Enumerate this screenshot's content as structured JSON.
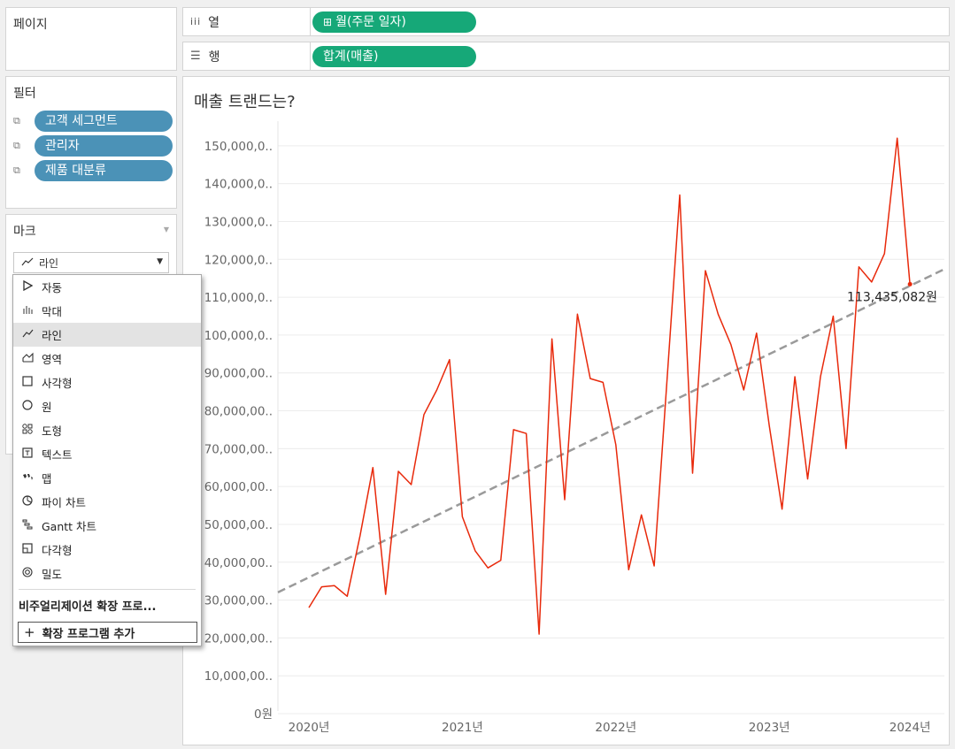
{
  "pages_panel": {
    "title": "페이지"
  },
  "columns_shelf": {
    "label": "열",
    "icon": "columns-icon",
    "pill": "월(주문 일자)"
  },
  "rows_shelf": {
    "label": "행",
    "icon": "rows-icon",
    "pill": "합계(매출)"
  },
  "filters_panel": {
    "title": "필터",
    "items": [
      "고객 세그먼트",
      "관리자",
      "제품 대분류"
    ]
  },
  "marks_panel": {
    "title": "마크",
    "selected": "라인"
  },
  "mark_type_menu": {
    "items": [
      {
        "label": "자동",
        "icon": "automatic-icon"
      },
      {
        "label": "막대",
        "icon": "bar-icon"
      },
      {
        "label": "라인",
        "icon": "line-icon"
      },
      {
        "label": "영역",
        "icon": "area-icon"
      },
      {
        "label": "사각형",
        "icon": "square-icon"
      },
      {
        "label": "원",
        "icon": "circle-icon"
      },
      {
        "label": "도형",
        "icon": "shape-icon"
      },
      {
        "label": "텍스트",
        "icon": "text-icon"
      },
      {
        "label": "맵",
        "icon": "map-icon"
      },
      {
        "label": "파이 차트",
        "icon": "pie-icon"
      },
      {
        "label": "Gantt 차트",
        "icon": "gantt-icon"
      },
      {
        "label": "다각형",
        "icon": "polygon-icon"
      },
      {
        "label": "밀도",
        "icon": "density-icon"
      }
    ],
    "selected_index": 2,
    "extensions_heading": "비주얼리제이션 확장 프로...",
    "add_extension_label": "확장 프로그램 추가"
  },
  "colors": {
    "line": "#e8290b",
    "trend": "#9a9a9a",
    "pill_green": "#16a878",
    "pill_blue": "#4b92b7"
  },
  "chart_data": {
    "type": "line",
    "title": "매출 트랜드는?",
    "x_tick_labels": [
      "2020년",
      "2021년",
      "2022년",
      "2023년",
      "2024년"
    ],
    "y_tick_labels": [
      "0원",
      "10,000,00..",
      "20,000,00..",
      "30,000,00..",
      "40,000,00..",
      "50,000,00..",
      "60,000,00..",
      "70,000,00..",
      "80,000,00..",
      "90,000,00..",
      "100,000,0..",
      "110,000,0..",
      "120,000,0..",
      "130,000,0..",
      "140,000,0..",
      "150,000,0.."
    ],
    "ylim": [
      0,
      160000000
    ],
    "x_start": "2020-01",
    "series": [
      {
        "values": [
          28000000,
          33500000,
          33800000,
          31000000,
          47000000,
          65000000,
          31500000,
          64000000,
          60500000,
          79000000,
          85500000,
          93500000,
          52000000,
          43000000,
          38500000,
          40500000,
          75000000,
          74000000,
          21000000,
          99000000,
          56500000,
          105500000,
          88500000,
          87500000,
          71000000,
          38000000,
          52500000,
          39000000,
          88000000,
          137000000,
          63500000,
          117000000,
          105500000,
          97500000,
          85500000,
          100500000,
          76000000,
          54000000,
          89000000,
          62000000,
          89000000,
          105000000,
          70000000,
          118000000,
          114000000,
          121500000,
          152000000,
          113435082
        ]
      }
    ],
    "trend_line": {
      "start": 36000000,
      "end": 113000000,
      "style": "dashed"
    },
    "last_value_label": "113,435,082원",
    "grid": "horizontal"
  }
}
